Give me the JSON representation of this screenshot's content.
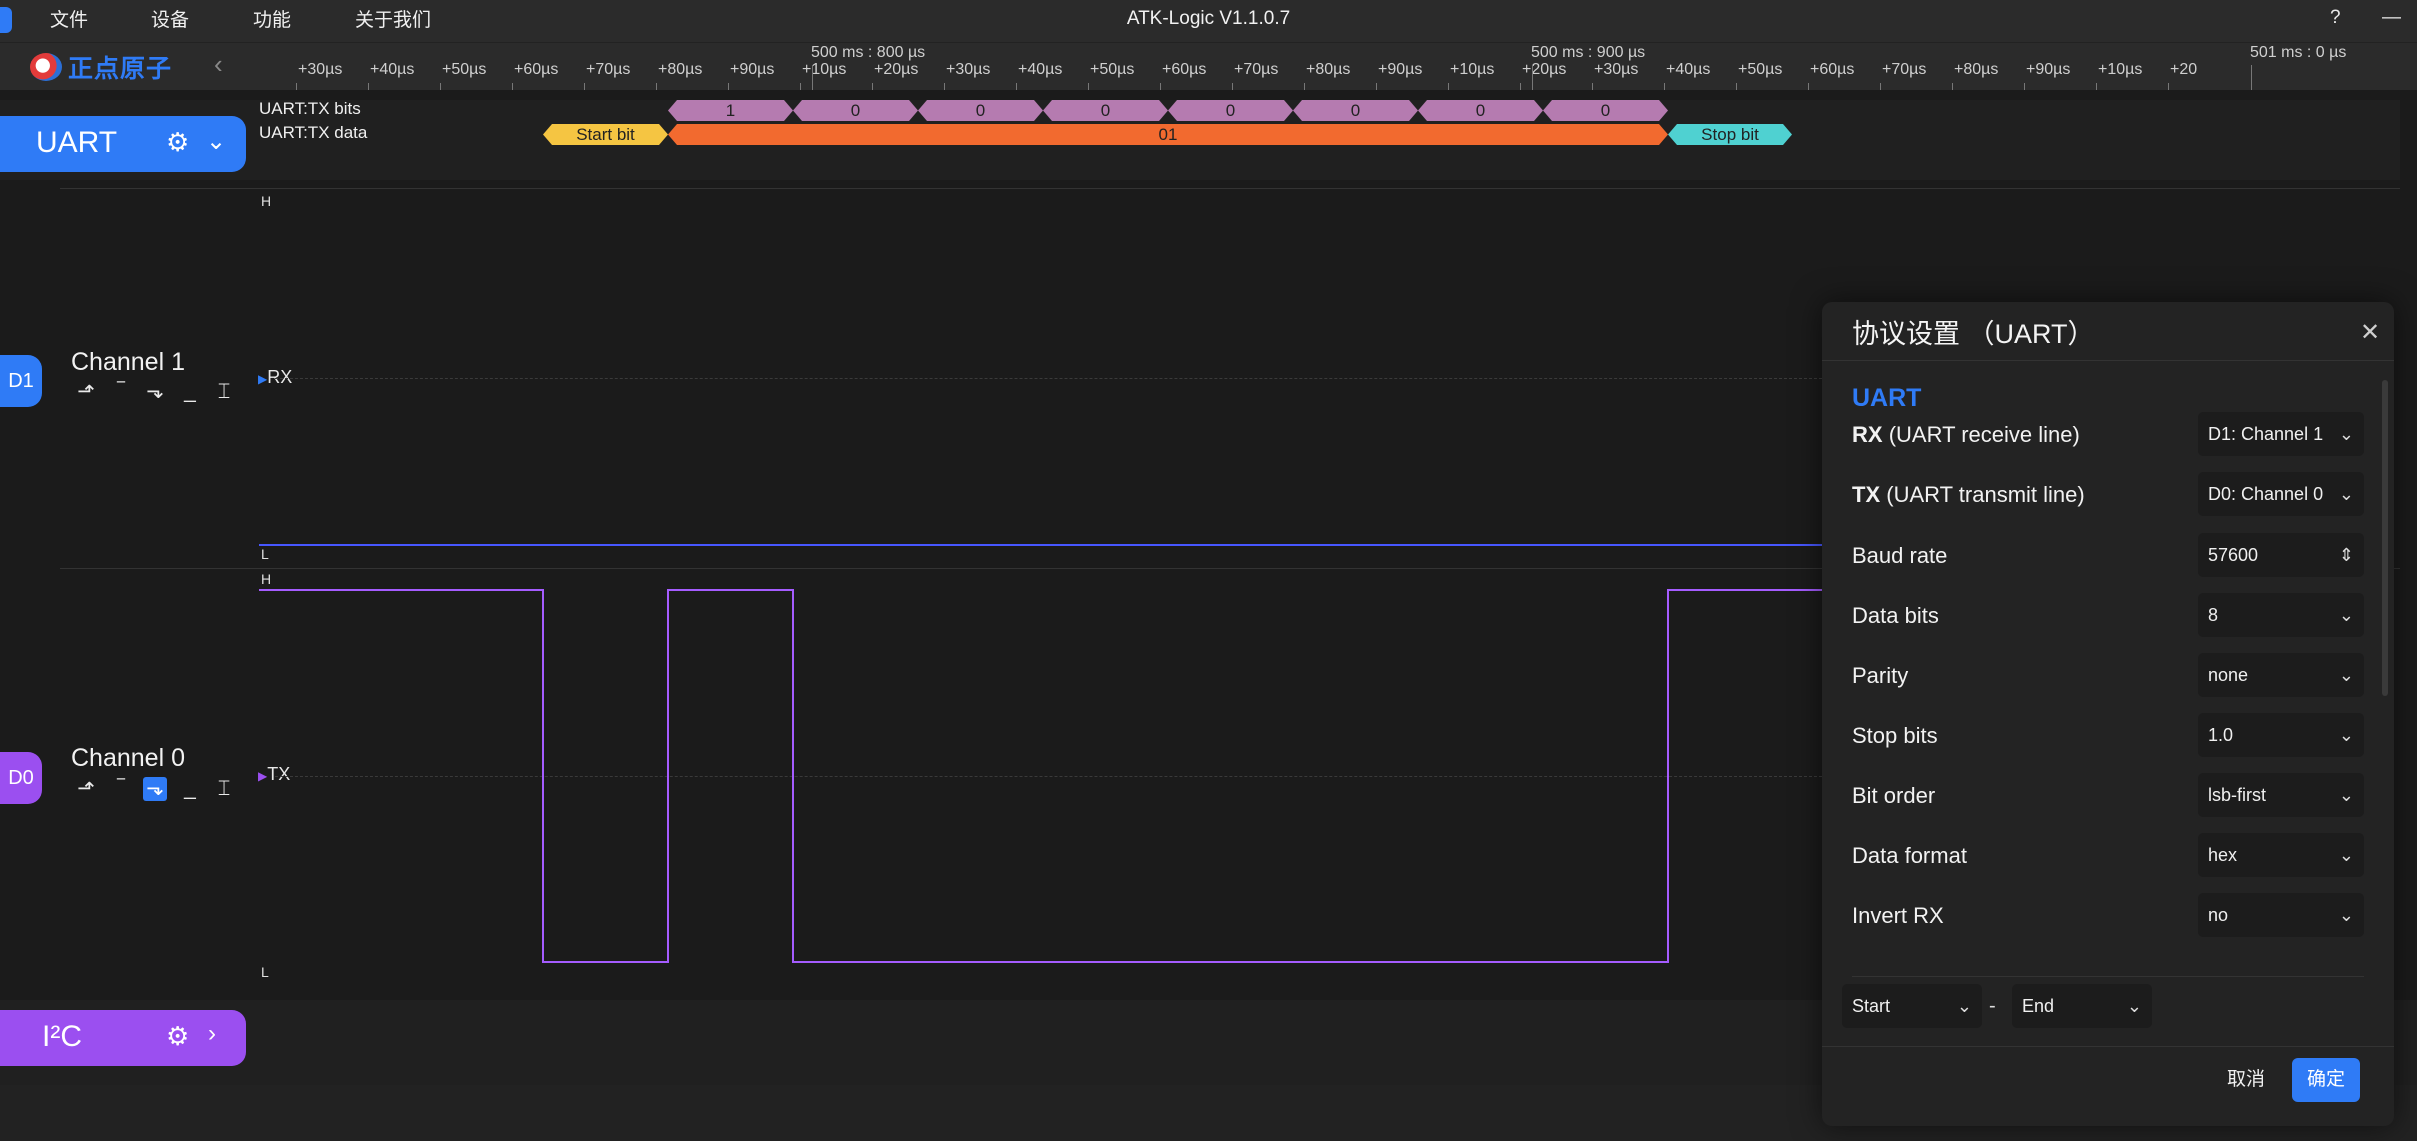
{
  "menu": {
    "file": "文件",
    "device": "设备",
    "function": "功能",
    "about": "关于我们"
  },
  "window": {
    "title": "ATK-Logic  V1.1.0.7",
    "help": "?",
    "minimize": "—"
  },
  "logo": {
    "text": "正点原子"
  },
  "ruler": {
    "ticks": [
      "+30µs",
      "+40µs",
      "+50µs",
      "+60µs",
      "+70µs",
      "+80µs",
      "+90µs",
      "+10µs",
      "+20µs",
      "+30µs",
      "+40µs",
      "+50µs",
      "+60µs",
      "+70µs",
      "+80µs",
      "+90µs",
      "+10µs",
      "+20µs",
      "+30µs",
      "+40µs",
      "+50µs",
      "+60µs",
      "+70µs",
      "+80µs",
      "+90µs",
      "+10µs",
      "+20"
    ],
    "markers": [
      "500 ms : 800 µs",
      "500 ms : 900 µs",
      "501 ms : 0 µs"
    ]
  },
  "decoders": {
    "uart": {
      "name": "UART",
      "rows": [
        "UART:TX bits",
        "UART:TX data"
      ]
    },
    "i2c": {
      "name": "I²C"
    }
  },
  "uart_decode": {
    "bits": [
      "1",
      "0",
      "0",
      "0",
      "0",
      "0",
      "0",
      "0"
    ],
    "start_label": "Start bit",
    "data_value": "01",
    "stop_label": "Stop bit"
  },
  "channels": [
    {
      "badge": "D1",
      "name": "Channel 1",
      "signal": "RX",
      "high": "H",
      "low": "L"
    },
    {
      "badge": "D0",
      "name": "Channel 0",
      "signal": "TX",
      "high": "H",
      "low": "L"
    }
  ],
  "trigger_icons": [
    "rising-edge-icon",
    "high-level-icon",
    "falling-edge-icon",
    "low-level-icon",
    "any-edge-icon"
  ],
  "dialog": {
    "title": "协议设置 （UART）",
    "section": "UART",
    "fields": [
      {
        "key": "RX",
        "label": "(UART receive line)",
        "value": "D1: Channel 1"
      },
      {
        "key": "TX",
        "label": "(UART transmit line)",
        "value": "D0: Channel 0"
      },
      {
        "key": "",
        "label": "Baud rate",
        "value": "57600"
      },
      {
        "key": "",
        "label": "Data bits",
        "value": "8"
      },
      {
        "key": "",
        "label": "Parity",
        "value": "none"
      },
      {
        "key": "",
        "label": "Stop bits",
        "value": "1.0"
      },
      {
        "key": "",
        "label": "Bit order",
        "value": "lsb-first"
      },
      {
        "key": "",
        "label": "Data format",
        "value": "hex"
      },
      {
        "key": "",
        "label": "Invert RX",
        "value": "no"
      }
    ],
    "range_start": "Start",
    "range_separator": "-",
    "range_end": "End",
    "cancel": "取消",
    "ok": "确定"
  },
  "colors": {
    "accent": "#2f7bf6",
    "uart_chip": "#2f7bf6",
    "i2c_chip": "#9b4ff0",
    "start_bit": "#f5c542",
    "data_bits": "#b57bb0",
    "data_byte": "#f26a2f",
    "stop_bit": "#4fd1d1",
    "rx_trace": "#4757ff",
    "tx_trace": "#a55cff"
  }
}
